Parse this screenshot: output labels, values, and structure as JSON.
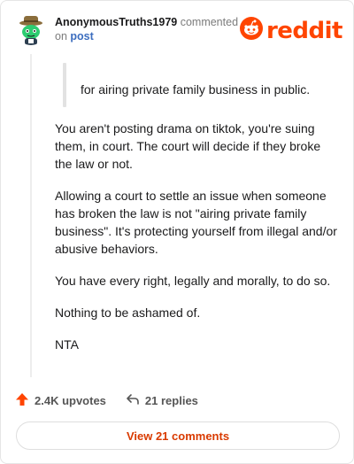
{
  "header": {
    "username": "AnonymousTruths1979",
    "commented_text": " commented",
    "on_text": "on ",
    "post_link": "post",
    "logo_text": "reddit"
  },
  "quote": {
    "text": "for airing private family business in public."
  },
  "comment": {
    "paragraphs": [
      "You aren't posting drama on tiktok, you're suing them, in court. The court will decide if they broke the law or not.",
      "Allowing a court to settle an issue when someone has broken the law is not \"airing private family business\". It's protecting yourself from illegal and/or abusive behaviors.",
      "You have every right, legally and morally, to do so.",
      "Nothing to be ashamed of.",
      "NTA"
    ]
  },
  "actions": {
    "upvotes": "2.4K upvotes",
    "replies": "21 replies"
  },
  "view_comments": "View 21 comments",
  "colors": {
    "brand": "#ff4500",
    "link": "#3d6ebf",
    "upvote": "#ff4500"
  },
  "icons": {
    "avatar": "snoo-avatar-with-hat",
    "logo": "reddit-snoo-icon",
    "upvote": "upvote-arrow-icon",
    "reply": "reply-arrow-icon"
  }
}
